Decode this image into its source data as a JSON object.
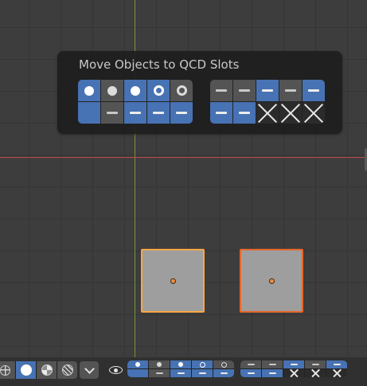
{
  "popup": {
    "title": "Move Objects to QCD Slots",
    "grid_left": {
      "top": [
        {
          "style": "blue",
          "glyph": "dot"
        },
        {
          "style": "grey",
          "glyph": "dot"
        },
        {
          "style": "blue",
          "glyph": "dot"
        },
        {
          "style": "blue",
          "glyph": "ring"
        },
        {
          "style": "grey",
          "glyph": "ring"
        }
      ],
      "bottom": [
        {
          "style": "blue",
          "glyph": "none"
        },
        {
          "style": "grey",
          "glyph": "dash"
        },
        {
          "style": "blue",
          "glyph": "dash"
        },
        {
          "style": "blue",
          "glyph": "dash"
        },
        {
          "style": "blue",
          "glyph": "dash"
        }
      ]
    },
    "grid_right": {
      "top": [
        {
          "style": "grey",
          "glyph": "dash"
        },
        {
          "style": "grey",
          "glyph": "dash"
        },
        {
          "style": "blue",
          "glyph": "dash"
        },
        {
          "style": "grey",
          "glyph": "dash"
        },
        {
          "style": "blue",
          "glyph": "dash"
        }
      ],
      "bottom": [
        {
          "style": "blue",
          "glyph": "dash"
        },
        {
          "style": "blue",
          "glyph": "dash"
        },
        {
          "style": "empty",
          "glyph": "x"
        },
        {
          "style": "empty",
          "glyph": "x"
        },
        {
          "style": "empty",
          "glyph": "x"
        }
      ]
    }
  },
  "header": {
    "shading_modes": [
      {
        "name": "wireframe-shading-icon",
        "active": false,
        "icon": "wire"
      },
      {
        "name": "solid-shading-icon",
        "active": true,
        "icon": "solid"
      },
      {
        "name": "material-preview-icon",
        "active": false,
        "icon": "mat"
      },
      {
        "name": "rendered-shading-icon",
        "active": false,
        "icon": "render"
      }
    ],
    "qcd_left": {
      "top": [
        {
          "style": "blue",
          "glyph": "dot"
        },
        {
          "style": "grey",
          "glyph": "dot"
        },
        {
          "style": "blue",
          "glyph": "dot"
        },
        {
          "style": "blue",
          "glyph": "ring"
        },
        {
          "style": "grey",
          "glyph": "ring"
        }
      ],
      "bottom": [
        {
          "style": "blue",
          "glyph": "none"
        },
        {
          "style": "grey",
          "glyph": "dash"
        },
        {
          "style": "blue",
          "glyph": "dash"
        },
        {
          "style": "blue",
          "glyph": "dash"
        },
        {
          "style": "blue",
          "glyph": "dash"
        }
      ]
    },
    "qcd_right": {
      "top": [
        {
          "style": "grey",
          "glyph": "dash"
        },
        {
          "style": "grey",
          "glyph": "dash"
        },
        {
          "style": "blue",
          "glyph": "dash"
        },
        {
          "style": "grey",
          "glyph": "dash"
        },
        {
          "style": "blue",
          "glyph": "dash"
        }
      ],
      "bottom": [
        {
          "style": "blue",
          "glyph": "dash"
        },
        {
          "style": "blue",
          "glyph": "dash"
        },
        {
          "style": "empty",
          "glyph": "x"
        },
        {
          "style": "empty",
          "glyph": "x"
        },
        {
          "style": "empty",
          "glyph": "x"
        }
      ]
    }
  },
  "colors": {
    "accent_blue": "#4772b3",
    "active_outline": "#ffa645",
    "selected_outline": "#e8662a"
  }
}
